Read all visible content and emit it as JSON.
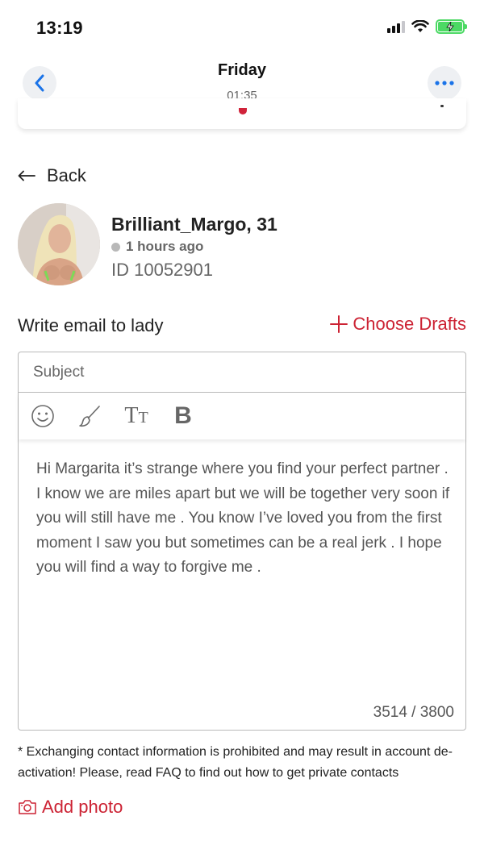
{
  "status_bar": {
    "time": "13:19",
    "icons": [
      "signal-icon",
      "wifi-icon",
      "battery-charging-icon"
    ]
  },
  "nav": {
    "title": "Friday",
    "subtitle": "01:35",
    "back_icon": "chevron-left-icon",
    "more_icon": "more-horizontal-icon"
  },
  "back": {
    "label": "Back",
    "icon": "arrow-left-icon"
  },
  "profile": {
    "name": "Brilliant_Margo, 31",
    "last_seen": "1 hours ago",
    "id": "ID 10052901"
  },
  "compose": {
    "title": "Write email to lady",
    "drafts_label": "Choose Drafts",
    "subject_placeholder": "Subject",
    "tools": [
      "smiley-icon",
      "brush-icon",
      "text-size-icon",
      "bold-icon"
    ],
    "bold_glyph": "B",
    "text_size_glyph_big": "T",
    "text_size_glyph_small": "T",
    "message": "Hi Margarita it’s strange where you find your perfect partner . I know we are miles apart but we will be together very soon if you will still have me . You know I’ve loved you from the first moment I saw you but sometimes can be a real jerk . I hope you will find a way to forgive me .",
    "counter": "3514 / 3800"
  },
  "notice": "* Exchanging contact information is prohibited and may result in account de-activation! Please, read FAQ to find out how to get private contacts",
  "add_photo": {
    "label": "Add photo",
    "icon": "camera-icon"
  },
  "colors": {
    "accent": "#cc2233",
    "link_blue": "#1a73e8",
    "battery_green": "#4cd964",
    "muted_text": "#666666"
  }
}
